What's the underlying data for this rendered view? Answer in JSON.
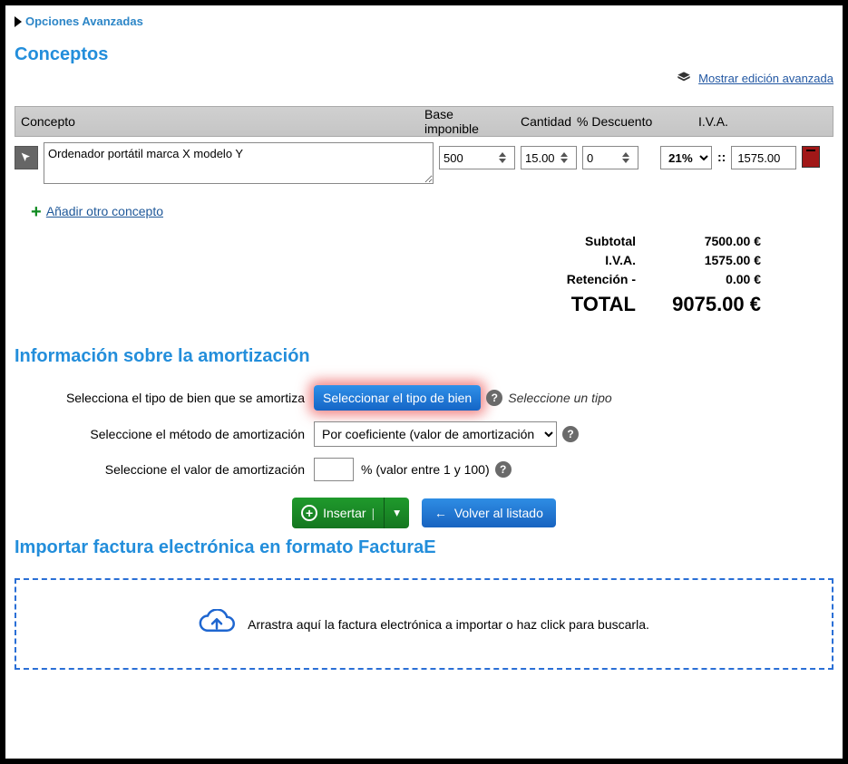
{
  "advanced_options": "Opciones Avanzadas",
  "sections": {
    "concepts": "Conceptos",
    "amort": "Información sobre la amortización",
    "import": "Importar factura electrónica en formato FacturaE"
  },
  "advanced_edit_link": "Mostrar edición avanzada",
  "table": {
    "headers": {
      "concepto": "Concepto",
      "base": "Base imponible",
      "cantidad": "Cantidad",
      "descuento": "% Descuento",
      "iva": "I.V.A."
    }
  },
  "row": {
    "concept": "Ordenador portátil marca X modelo Y",
    "base": "500",
    "qty": "15.00",
    "discount": "0",
    "iva": "21%",
    "iva_amount": "1575.00"
  },
  "add_concept": "Añadir otro concepto",
  "totals": {
    "subtotal_lbl": "Subtotal",
    "subtotal_val": "7500.00 €",
    "iva_lbl": "I.V.A.",
    "iva_val": "1575.00 €",
    "ret_lbl": "Retención -",
    "ret_val": "0.00 €",
    "total_lbl": "TOTAL",
    "total_val": "9075.00 €"
  },
  "amort": {
    "label_tipo": "Selecciona el tipo de bien que se amortiza",
    "btn_tipo": "Seleccionar el tipo de bien",
    "hint_tipo": "Seleccione un tipo",
    "label_metodo": "Seleccione el método de amortización",
    "select_metodo": "Por coeficiente (valor de amortización anual)",
    "label_valor": "Seleccione el valor de amortización",
    "valor_hint": "% (valor entre 1 y 100)",
    "valor": ""
  },
  "buttons": {
    "insert": "Insertar",
    "back": "Volver al listado"
  },
  "dropzone": "Arrastra aquí la factura electrónica a importar o haz click para buscarla.",
  "separator": "::"
}
